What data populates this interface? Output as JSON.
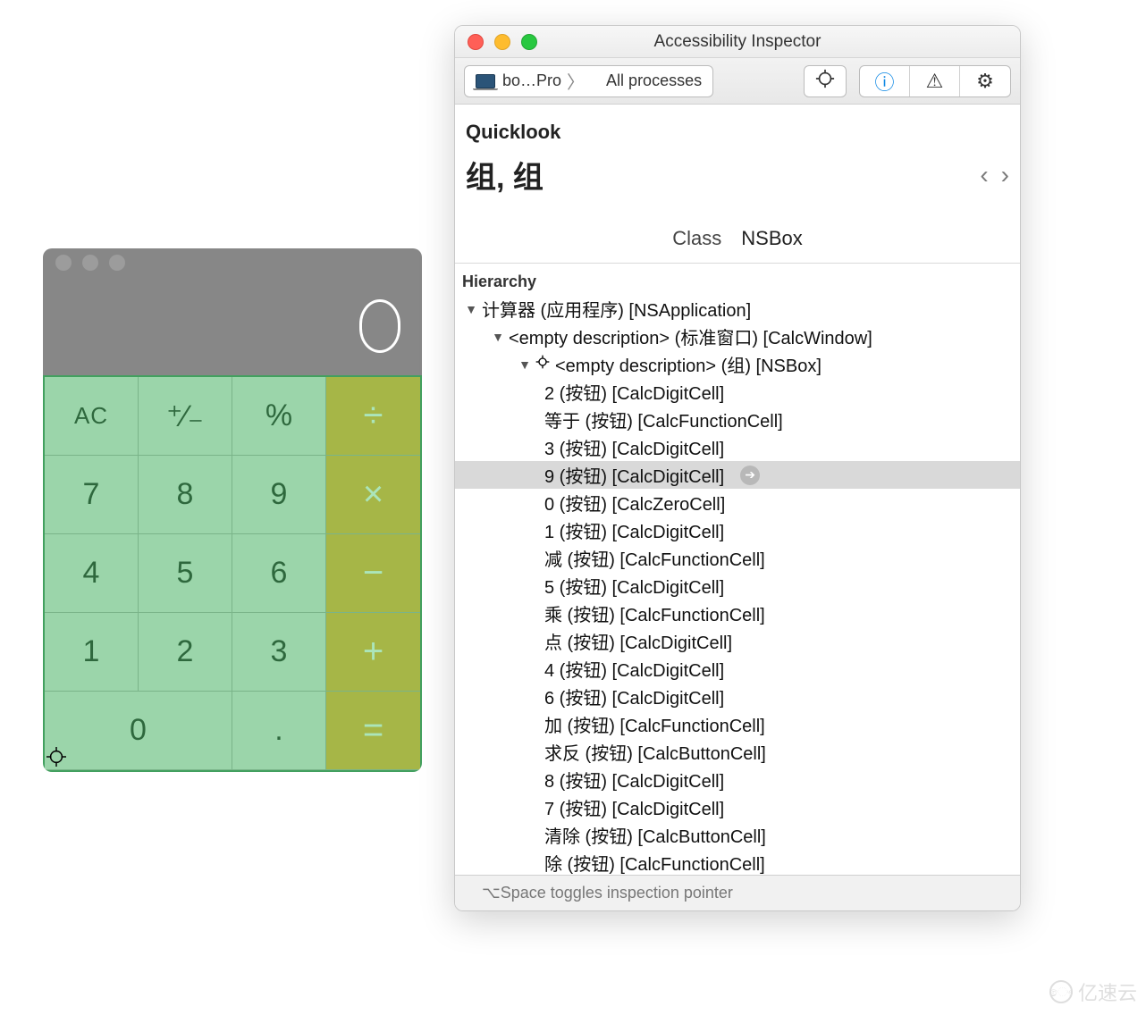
{
  "calculator": {
    "display": "0",
    "buttons": {
      "ac": "AC",
      "negate": "⁺∕₋",
      "percent": "%",
      "divide": "÷",
      "seven": "7",
      "eight": "8",
      "nine": "9",
      "multiply": "×",
      "four": "4",
      "five": "5",
      "six": "6",
      "minus": "−",
      "one": "1",
      "two": "2",
      "three": "3",
      "plus": "+",
      "zero": "0",
      "dot": ".",
      "equals": "="
    }
  },
  "inspector": {
    "title": "Accessibility Inspector",
    "toolbar": {
      "device": "bo…Pro",
      "process": "All processes"
    },
    "quicklook": {
      "label": "Quicklook",
      "name": "组, 组",
      "nav_prev": "‹",
      "nav_next": "›"
    },
    "class_row": {
      "label": "Class",
      "value": "NSBox"
    },
    "hierarchy_label": "Hierarchy",
    "tree": [
      {
        "depth": 0,
        "open": true,
        "selected": false,
        "hasCrosshair": false,
        "label": "计算器 (应用程序) [NSApplication]"
      },
      {
        "depth": 1,
        "open": true,
        "selected": false,
        "hasCrosshair": false,
        "label": "<empty description> (标准窗口) [CalcWindow]"
      },
      {
        "depth": 2,
        "open": true,
        "selected": false,
        "hasCrosshair": true,
        "label": "<empty description> (组) [NSBox]"
      },
      {
        "depth": 3,
        "open": false,
        "selected": false,
        "hasCrosshair": false,
        "label": "2 (按钮) [CalcDigitCell]"
      },
      {
        "depth": 3,
        "open": false,
        "selected": false,
        "hasCrosshair": false,
        "label": "等于 (按钮) [CalcFunctionCell]"
      },
      {
        "depth": 3,
        "open": false,
        "selected": false,
        "hasCrosshair": false,
        "label": "3 (按钮) [CalcDigitCell]"
      },
      {
        "depth": 3,
        "open": false,
        "selected": true,
        "hasCrosshair": false,
        "label": "9 (按钮) [CalcDigitCell]"
      },
      {
        "depth": 3,
        "open": false,
        "selected": false,
        "hasCrosshair": false,
        "label": "0 (按钮) [CalcZeroCell]"
      },
      {
        "depth": 3,
        "open": false,
        "selected": false,
        "hasCrosshair": false,
        "label": "1 (按钮) [CalcDigitCell]"
      },
      {
        "depth": 3,
        "open": false,
        "selected": false,
        "hasCrosshair": false,
        "label": "减 (按钮) [CalcFunctionCell]"
      },
      {
        "depth": 3,
        "open": false,
        "selected": false,
        "hasCrosshair": false,
        "label": "5 (按钮) [CalcDigitCell]"
      },
      {
        "depth": 3,
        "open": false,
        "selected": false,
        "hasCrosshair": false,
        "label": "乘 (按钮) [CalcFunctionCell]"
      },
      {
        "depth": 3,
        "open": false,
        "selected": false,
        "hasCrosshair": false,
        "label": "点 (按钮) [CalcDigitCell]"
      },
      {
        "depth": 3,
        "open": false,
        "selected": false,
        "hasCrosshair": false,
        "label": "4 (按钮) [CalcDigitCell]"
      },
      {
        "depth": 3,
        "open": false,
        "selected": false,
        "hasCrosshair": false,
        "label": "6 (按钮) [CalcDigitCell]"
      },
      {
        "depth": 3,
        "open": false,
        "selected": false,
        "hasCrosshair": false,
        "label": "加 (按钮) [CalcFunctionCell]"
      },
      {
        "depth": 3,
        "open": false,
        "selected": false,
        "hasCrosshair": false,
        "label": "求反 (按钮) [CalcButtonCell]"
      },
      {
        "depth": 3,
        "open": false,
        "selected": false,
        "hasCrosshair": false,
        "label": "8 (按钮) [CalcDigitCell]"
      },
      {
        "depth": 3,
        "open": false,
        "selected": false,
        "hasCrosshair": false,
        "label": "7 (按钮) [CalcDigitCell]"
      },
      {
        "depth": 3,
        "open": false,
        "selected": false,
        "hasCrosshair": false,
        "label": "清除 (按钮) [CalcButtonCell]"
      },
      {
        "depth": 3,
        "open": false,
        "selected": false,
        "hasCrosshair": false,
        "label": "除 (按钮) [CalcFunctionCell]"
      }
    ],
    "footer_hint": "⌥Space toggles inspection pointer"
  },
  "watermark": "亿速云"
}
